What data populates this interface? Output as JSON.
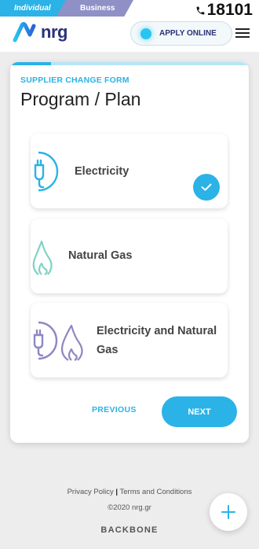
{
  "topbar": {
    "tab_individual": "Individual",
    "tab_business": "Business",
    "hotline": "18101"
  },
  "header": {
    "logo_text": "nrg",
    "apply_label": "APPLY ONLINE"
  },
  "form": {
    "section_label": "SUPPLIER CHANGE FORM",
    "title": "Program / Plan",
    "progress_fraction": 0.17,
    "options": [
      {
        "label": "Electricity",
        "icon": "electric-plug-icon",
        "selected": true
      },
      {
        "label": "Natural Gas",
        "icon": "gas-flame-icon",
        "selected": false
      },
      {
        "label_line1": "Electricity and Natural",
        "label_line2": "Gas",
        "icon": "plug-and-flame-icon",
        "selected": false
      }
    ],
    "prev_label": "PREVIOUS",
    "next_label": "NEXT"
  },
  "footer": {
    "privacy": "Privacy Policy",
    "separator": "|",
    "terms": "Terms and Conditions",
    "copyright": "©2020 nrg.gr",
    "brand": "BACKBONE"
  },
  "colors": {
    "accent": "#2bb2e6",
    "business_tab": "#8e90c6",
    "navy": "#2a3277",
    "gas_icon": "#7fd3c7",
    "combo_icon": "#8e87c2"
  }
}
